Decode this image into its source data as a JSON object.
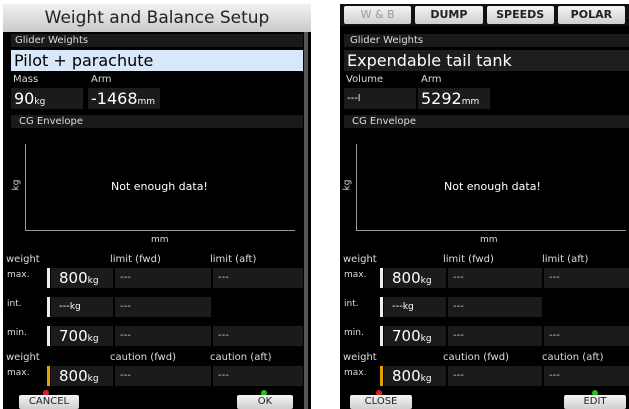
{
  "left": {
    "title": "Weight and Balance Setup",
    "glider_weights": "Glider Weights",
    "item": "Pilot + parachute",
    "mass_label": "Mass",
    "arm_label": "Arm",
    "mass_value": "90",
    "mass_unit": "kg",
    "arm_value": "-1468",
    "arm_unit": "mm",
    "cg_envelope": "CG Envelope",
    "y_unit": "kg",
    "x_unit": "mm",
    "no_data": "Not enough data!",
    "table": {
      "h_weight": "weight",
      "h_fwd": "limit (fwd)",
      "h_aft": "limit (aft)",
      "rows": [
        {
          "label": "max.",
          "value": "800",
          "unit": "kg",
          "fwd": "---",
          "aft": "---"
        },
        {
          "label": "int.",
          "value": "---",
          "unit": "kg",
          "fwd": "---",
          "aft": ""
        },
        {
          "label": "min.",
          "value": "700",
          "unit": "kg",
          "fwd": "---",
          "aft": "---"
        }
      ],
      "c_weight": "weight",
      "c_fwd": "caution (fwd)",
      "c_aft": "caution (aft)",
      "caution": {
        "label": "max.",
        "value": "800",
        "unit": "kg",
        "fwd": "---",
        "aft": "---"
      }
    },
    "btn_left": "CANCEL",
    "btn_right": "OK"
  },
  "right": {
    "tabs": [
      "W & B",
      "DUMP",
      "SPEEDS",
      "POLAR"
    ],
    "glider_weights": "Glider Weights",
    "item": "Expendable tail tank",
    "vol_label": "Volume",
    "arm_label": "Arm",
    "vol_value": "---",
    "vol_unit": "l",
    "arm_value": "5292",
    "arm_unit": "mm",
    "cg_envelope": "CG Envelope",
    "y_unit": "kg",
    "x_unit": "mm",
    "no_data": "Not enough data!",
    "table": {
      "h_weight": "weight",
      "h_fwd": "limit (fwd)",
      "h_aft": "limit (aft)",
      "rows": [
        {
          "label": "max.",
          "value": "800",
          "unit": "kg",
          "fwd": "---",
          "aft": "---"
        },
        {
          "label": "int.",
          "value": "---",
          "unit": "kg",
          "fwd": "---",
          "aft": ""
        },
        {
          "label": "min.",
          "value": "700",
          "unit": "kg",
          "fwd": "---",
          "aft": "---"
        }
      ],
      "c_weight": "weight",
      "c_fwd": "caution (fwd)",
      "c_aft": "caution (aft)",
      "caution": {
        "label": "max.",
        "value": "800",
        "unit": "kg",
        "fwd": "---",
        "aft": "---"
      }
    },
    "btn_left": "CLOSE",
    "btn_right": "EDIT"
  },
  "colors": {
    "bar_white": "#eeeeee",
    "bar_caution": "#e8a000",
    "dot_red": "#e02020",
    "dot_green": "#20c020",
    "highlight": "#d8e8fa"
  }
}
